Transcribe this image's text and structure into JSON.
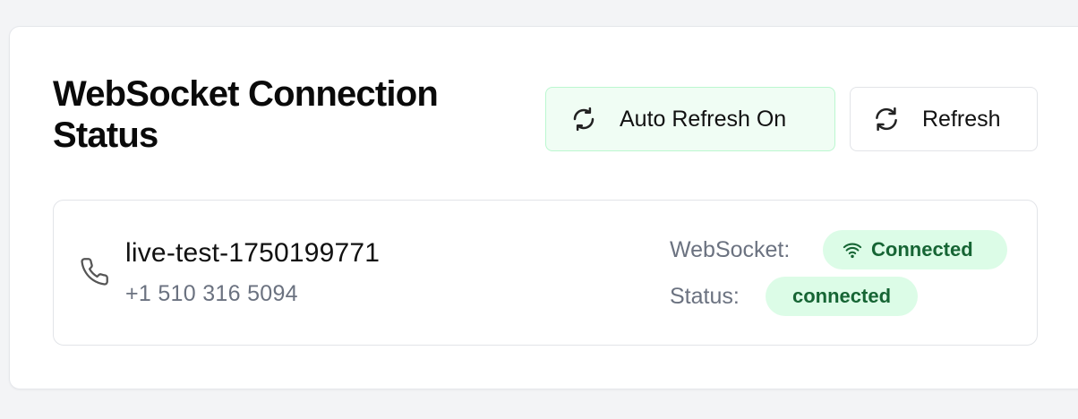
{
  "header": {
    "title": "WebSocket Connection Status"
  },
  "toolbar": {
    "auto_refresh_label": "Auto Refresh On",
    "auto_refresh_icon": "refresh-cycle-icon",
    "refresh_label": "Refresh",
    "refresh_icon": "refresh-icon"
  },
  "connection": {
    "icon": "phone-icon",
    "name": "live-test-1750199771",
    "number": "+1 510 316 5094",
    "websocket_label": "WebSocket:",
    "websocket_value": "Connected",
    "websocket_icon": "wifi-icon",
    "status_label": "Status:",
    "status_value": "connected"
  },
  "colors": {
    "accent_green_bg": "#dcfce7",
    "accent_green_text": "#166534",
    "auto_refresh_bg": "#f0fdf4",
    "auto_refresh_border": "#bbf7d0"
  }
}
